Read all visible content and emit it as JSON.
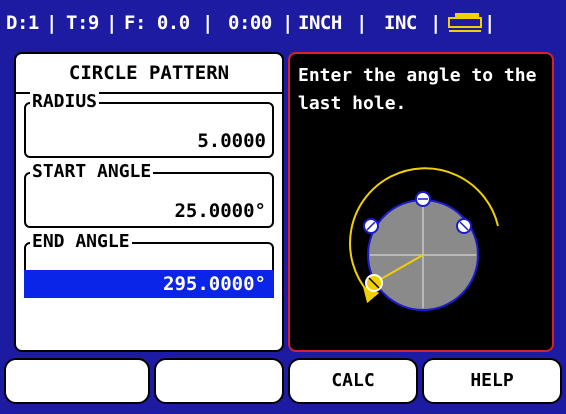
{
  "status_bar": {
    "datum": "D:1",
    "tool": "T:9",
    "feed": "F: 0.0",
    "time": "0:00",
    "units": "INCH",
    "mode": "INC",
    "icon": "tool-holder-icon"
  },
  "form": {
    "title": "CIRCLE PATTERN",
    "fields": [
      {
        "label": "RADIUS",
        "value": "5.0000"
      },
      {
        "label": "START ANGLE",
        "value": "25.0000°"
      },
      {
        "label": "END ANGLE",
        "value": "295.0000°"
      }
    ]
  },
  "help": {
    "instruction": "Enter the angle to the last hole.",
    "diagram": "circle-pattern-end-angle-icon"
  },
  "softkeys": [
    "",
    "",
    "CALC",
    "HELP"
  ],
  "colors": {
    "background": "#1e1ba3",
    "highlight": "#0a24e8",
    "help_border": "#d8222b",
    "arc": "#f0d000"
  }
}
